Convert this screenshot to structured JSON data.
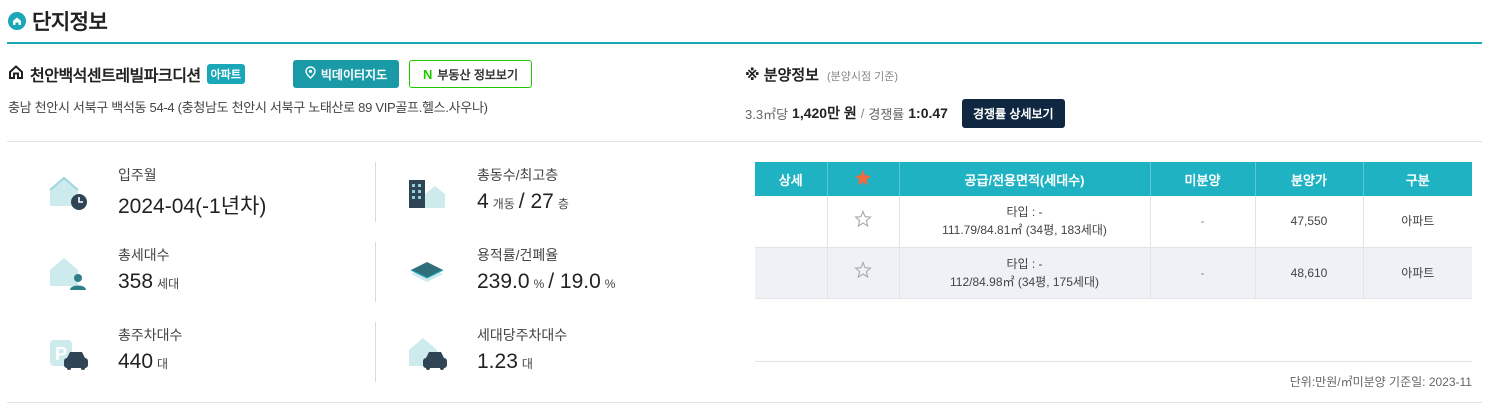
{
  "section": {
    "title": "단지정보",
    "icon": "home-circle-icon"
  },
  "complex": {
    "name": "천안백석센트레빌파크디션",
    "badge": "아파트",
    "address": "충남 천안시 서북구 백석동 54-4 (충청남도 천안시 서북구 노태산로 89 VIP골프.헬스.사우나)",
    "bigdata_button": "빅데이터지도",
    "naver_button": "부동산 정보보기",
    "naver_logo": "N"
  },
  "sale": {
    "title": "※ 분양정보",
    "subtitle": "(분양시점 기준)",
    "price_label": "3.3㎡당",
    "price_value": "1,420만 원",
    "separator": "/",
    "competition_label": "경쟁률",
    "competition_value": "1:0.47",
    "detail_button": "경쟁률 상세보기"
  },
  "stats": [
    {
      "label": "입주월",
      "value": "2024-04(-1년차)",
      "icon": "house-clock-icon"
    },
    {
      "label": "총동수/최고층",
      "value1": "4",
      "unit1": "개동",
      "sep": "/",
      "value2": "27",
      "unit2": "층",
      "icon": "buildings-icon"
    },
    {
      "label": "총세대수",
      "value": "358",
      "unit": "세대",
      "icon": "house-person-icon"
    },
    {
      "label": "용적률/건폐율",
      "value1": "239.0",
      "unit1": "%",
      "sep": "/",
      "value2": "19.0",
      "unit2": "%",
      "icon": "layers-icon"
    },
    {
      "label": "총주차대수",
      "value": "440",
      "unit": "대",
      "icon": "parking-car-icon"
    },
    {
      "label": "세대당주차대수",
      "value": "1.23",
      "unit": "대",
      "icon": "house-car-icon"
    }
  ],
  "table": {
    "headers": [
      "상세",
      "★",
      "공급/전용면적(세대수)",
      "미분양",
      "분양가",
      "구분"
    ],
    "rows": [
      {
        "type_line": "타입 : -",
        "area_line": "111.79/84.81㎡ (34평, 183세대)",
        "unsold": "-",
        "price": "47,550",
        "kind": "아파트"
      },
      {
        "type_line": "타입 : -",
        "area_line": "112/84.98㎡ (34평, 175세대)",
        "unsold": "-",
        "price": "48,610",
        "kind": "아파트"
      }
    ],
    "unit_note": "단위:만원/㎡미분양 기준일: 2023-11"
  },
  "colors": {
    "accent": "#1aa7b8",
    "table_header": "#1fb2c3",
    "dark_button": "#0f2740",
    "naver_green": "#1ec800",
    "star": "#f26b3a"
  }
}
